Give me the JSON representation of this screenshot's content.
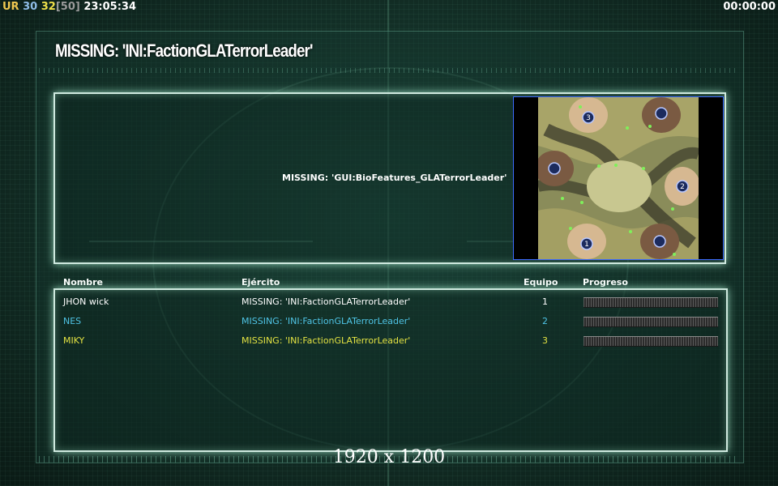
{
  "hud": {
    "prefix": "UR",
    "fps": "30",
    "count": "32",
    "limit": "[50]",
    "clock": "23:05:34",
    "timer": "00:00:00"
  },
  "title": "MISSING: 'INI:FactionGLATerrorLeader'",
  "bio_text": "MISSING: 'GUI:BioFeatures_GLATerrorLeader'",
  "map": {
    "start_positions": [
      "1",
      "2",
      "3"
    ]
  },
  "columns": {
    "name": "Nombre",
    "army": "Ejército",
    "team": "Equipo",
    "progress": "Progreso"
  },
  "players": [
    {
      "name": "JHON wick",
      "army": "MISSING: 'INI:FactionGLATerrorLeader'",
      "team": "1",
      "color": "#ffffff"
    },
    {
      "name": "NES",
      "army": "MISSING: 'INI:FactionGLATerrorLeader'",
      "team": "2",
      "color": "#4fc4e6"
    },
    {
      "name": "MIKY",
      "army": "MISSING: 'INI:FactionGLATerrorLeader'",
      "team": "3",
      "color": "#e3e242"
    }
  ],
  "resolution": "1920 x 1200"
}
